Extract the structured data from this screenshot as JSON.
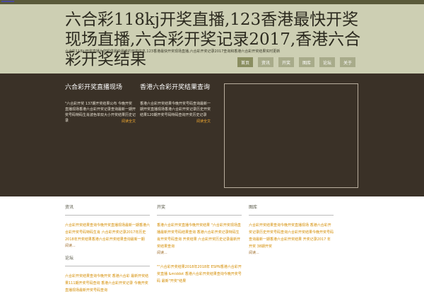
{
  "topbar": {
    "link_text": "━━━━━"
  },
  "header": {
    "title": "六合彩118kj开奖直播,123香港最快开奖现场直播,六合彩开奖记录2017,香港六合彩开奖结果",
    "tagline": "六合彩118kj开奖直播为您提供最快最准的开奖信息,123香港最快开奖现场直播,六合彩开奖记录2017查询和香港六合彩开奖结果实时更新"
  },
  "nav": {
    "items": [
      "首页",
      "资讯",
      "开奖",
      "图库",
      "论坛",
      "关于"
    ]
  },
  "features": [
    {
      "title": "六合彩开奖直播现场",
      "text": "\"六合彩开奖 137期开奖结果公布 今晚开奖直播现场香港六合彩开奖记录查询最新一期开奖号码特码生肖波色单双大小开奖结果历史记录",
      "more": "阅读全文"
    },
    {
      "title": "香港六合彩开奖结果查询",
      "text": "香港六合彩开奖结果今晚开奖号码查询最新一期开奖直播现场香港六合彩开奖记录历史开奖结果120期开奖号码特码查询开奖历史记录",
      "more": "阅读全文"
    }
  ],
  "columns": [
    {
      "heading": "资讯",
      "text": "六合彩开奖结果查询今晚开奖直播现场最新一期香港六合彩开奖号码特码生肖 六合彩开奖记录2017年历史 2018年开奖结果香港六合彩开奖结果查询最新一期",
      "more": "阅读..."
    },
    {
      "heading": "开奖",
      "text": "香港六合彩开奖直播今晚开奖结果 \"六合彩开奖现场直播最新开奖号码结果查询 香港六合彩开奖记录特码生肖开奖号码查询 开奖结果 六合彩开奖历史记录最新开奖结果查询",
      "more": "阅读..."
    },
    {
      "heading": "图库",
      "text": "六合彩开奖结果查询今晚开奖直播现场 香港六合彩开奖记录历史开奖号码查询六合彩开奖结果今晚开奖号码查询最新一期香港六合彩开奖结果 开奖记录2017 年开奖 38期开奖",
      "more": "阅读..."
    },
    {
      "heading": "论坛",
      "text": "六合彩开奖结果查询今晚开奖 香港六合彩 最新开奖结果111期开奖号码查询 香港六合彩开奖记录 今晚开奖直播现场最新开奖号码查询",
      "more": ""
    },
    {
      "heading": "",
      "text": "\"\"六合彩开奖结果2018年2018年 ESPN香港六合彩开奖直播 &middot 香港六合彩开奖结果查询今晚开奖号码 最新\"开奖\"结果",
      "more": ""
    }
  ]
}
